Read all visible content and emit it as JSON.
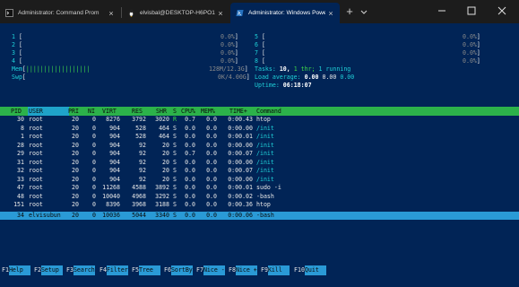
{
  "tabs": [
    {
      "label": "Administrator: Command Prom",
      "icon": "cmd-icon",
      "active": false
    },
    {
      "label": "elvisbal@DESKTOP-H6PO1TF: ~",
      "icon": "linux-penguin-icon",
      "active": false
    },
    {
      "label": "Administrator: Windows Powe",
      "icon": "powershell-icon",
      "active": true
    }
  ],
  "new_tab_label": "+",
  "tab_close_glyph": "×",
  "window_buttons": [
    "minimize-icon",
    "maximize-icon",
    "close-icon"
  ],
  "cpu_left": [
    {
      "id": "1",
      "pct": "0.0%"
    },
    {
      "id": "2",
      "pct": "0.0%"
    },
    {
      "id": "3",
      "pct": "0.0%"
    },
    {
      "id": "4",
      "pct": "0.0%"
    }
  ],
  "cpu_right": [
    {
      "id": "5",
      "pct": "0.0%"
    },
    {
      "id": "6",
      "pct": "0.0%"
    },
    {
      "id": "7",
      "pct": "0.0%"
    },
    {
      "id": "8",
      "pct": "0.0%"
    }
  ],
  "mem": {
    "label": "Mem",
    "bars": "||||||||||||||||||",
    "value": "128M/12.3G",
    "fill_fraction": 0.11
  },
  "swp": {
    "label": "Swp",
    "value": "0K/4.00G"
  },
  "tasks": {
    "prefix": "Tasks:",
    "count": "10,",
    "thr": "1 thr;",
    "running": "1 running"
  },
  "load": {
    "prefix": "Load average:",
    "v1": "0.00",
    "v2": "0.00",
    "v3": "0.00"
  },
  "uptime": {
    "prefix": "Uptime:",
    "value": "06:18:07"
  },
  "columns": [
    "PID",
    "USER",
    "PRI",
    "NI",
    "VIRT",
    "RES",
    "SHR",
    "S",
    "CPU%",
    "MEM%",
    "TIME+",
    "Command"
  ],
  "processes": [
    {
      "pid": "30",
      "user": "root",
      "pri": "20",
      "ni": "0",
      "virt": "8276",
      "res": "3792",
      "shr": "3020",
      "s": "R",
      "cpu": "0.7",
      "mem": "0.0",
      "time": "0:00.43",
      "cmd": "htop",
      "selected": false
    },
    {
      "pid": "8",
      "user": "root",
      "pri": "20",
      "ni": "0",
      "virt": "904",
      "res": "528",
      "shr": "464",
      "s": "S",
      "cpu": "0.0",
      "mem": "0.0",
      "time": "0:00.00",
      "cmd": "/init",
      "selected": false
    },
    {
      "pid": "1",
      "user": "root",
      "pri": "20",
      "ni": "0",
      "virt": "904",
      "res": "528",
      "shr": "464",
      "s": "S",
      "cpu": "0.0",
      "mem": "0.0",
      "time": "0:00.01",
      "cmd": "/init",
      "selected": false
    },
    {
      "pid": "28",
      "user": "root",
      "pri": "20",
      "ni": "0",
      "virt": "904",
      "res": "92",
      "shr": "20",
      "s": "S",
      "cpu": "0.0",
      "mem": "0.0",
      "time": "0:00.00",
      "cmd": "/init",
      "selected": false
    },
    {
      "pid": "29",
      "user": "root",
      "pri": "20",
      "ni": "0",
      "virt": "904",
      "res": "92",
      "shr": "20",
      "s": "S",
      "cpu": "0.7",
      "mem": "0.0",
      "time": "0:00.07",
      "cmd": "/init",
      "selected": false
    },
    {
      "pid": "31",
      "user": "root",
      "pri": "20",
      "ni": "0",
      "virt": "904",
      "res": "92",
      "shr": "20",
      "s": "S",
      "cpu": "0.0",
      "mem": "0.0",
      "time": "0:00.00",
      "cmd": "/init",
      "selected": false
    },
    {
      "pid": "32",
      "user": "root",
      "pri": "20",
      "ni": "0",
      "virt": "904",
      "res": "92",
      "shr": "20",
      "s": "S",
      "cpu": "0.0",
      "mem": "0.0",
      "time": "0:00.07",
      "cmd": "/init",
      "selected": false
    },
    {
      "pid": "33",
      "user": "root",
      "pri": "20",
      "ni": "0",
      "virt": "904",
      "res": "92",
      "shr": "20",
      "s": "S",
      "cpu": "0.0",
      "mem": "0.0",
      "time": "0:00.00",
      "cmd": "/init",
      "selected": false
    },
    {
      "pid": "47",
      "user": "root",
      "pri": "20",
      "ni": "0",
      "virt": "11268",
      "res": "4588",
      "shr": "3892",
      "s": "S",
      "cpu": "0.0",
      "mem": "0.0",
      "time": "0:00.01",
      "cmd": "sudo -i",
      "selected": false
    },
    {
      "pid": "48",
      "user": "root",
      "pri": "20",
      "ni": "0",
      "virt": "10040",
      "res": "4968",
      "shr": "3292",
      "s": "S",
      "cpu": "0.0",
      "mem": "0.0",
      "time": "0:00.02",
      "cmd": "-bash",
      "selected": false
    },
    {
      "pid": "151",
      "user": "root",
      "pri": "20",
      "ni": "0",
      "virt": "8396",
      "res": "3968",
      "shr": "3188",
      "s": "S",
      "cpu": "0.0",
      "mem": "0.0",
      "time": "0:00.36",
      "cmd": "htop",
      "selected": false
    },
    {
      "pid": "34",
      "user": "elvisubun",
      "pri": "20",
      "ni": "0",
      "virt": "10036",
      "res": "5044",
      "shr": "3340",
      "s": "S",
      "cpu": "0.0",
      "mem": "0.0",
      "time": "0:00.06",
      "cmd": "-bash",
      "selected": true
    }
  ],
  "fkeys": [
    {
      "key": "F1",
      "label": "Help  "
    },
    {
      "key": "F2",
      "label": "Setup "
    },
    {
      "key": "F3",
      "label": "Search"
    },
    {
      "key": "F4",
      "label": "Filter"
    },
    {
      "key": "F5",
      "label": "Tree  "
    },
    {
      "key": "F6",
      "label": "SortBy"
    },
    {
      "key": "F7",
      "label": "Nice -"
    },
    {
      "key": "F8",
      "label": "Nice +"
    },
    {
      "key": "F9",
      "label": "Kill  "
    },
    {
      "key": "F10",
      "label": "Quit  "
    }
  ],
  "colors": {
    "background": "#012456",
    "header_green": "#2cb24a",
    "selection": "#2a9ad6",
    "cyan": "#1fd0d8"
  }
}
